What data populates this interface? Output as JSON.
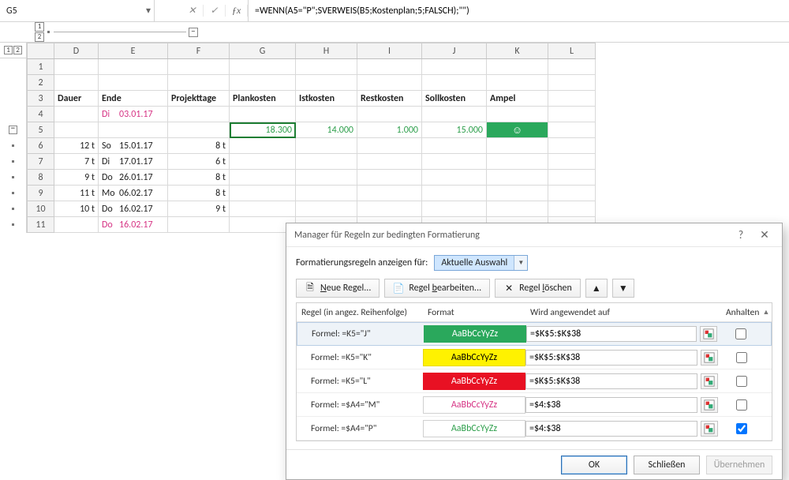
{
  "nameBox": "G5",
  "formula": "=WENN(A5=\"P\";SVERWEIS(B5;Kostenplan;5;FALSCH);\"\")",
  "outlineCols": {
    "one": "1",
    "two": "2"
  },
  "colHeads": [
    "D",
    "E",
    "F",
    "G",
    "H",
    "I",
    "J",
    "K",
    "L"
  ],
  "rowNums": [
    "1",
    "2",
    "3",
    "4",
    "5",
    "6",
    "7",
    "8",
    "9",
    "10",
    "11"
  ],
  "headers": {
    "D": "Dauer",
    "E": "Ende",
    "F": "Projekttage",
    "G": "Plankosten",
    "H": "Istkosten",
    "I": "Restkosten",
    "J": "Sollkosten",
    "K": "Ampel"
  },
  "row4": {
    "day": "Di",
    "date": "03.01.17"
  },
  "row5": {
    "G": "18.300",
    "H": "14.000",
    "I": "1.000",
    "J": "15.000",
    "K": "☺"
  },
  "rows": [
    {
      "n": "6",
      "D": "12 t",
      "day": "So",
      "date": "15.01.17",
      "F": "8 t"
    },
    {
      "n": "7",
      "D": "7 t",
      "day": "Di",
      "date": "17.01.17",
      "F": "6 t"
    },
    {
      "n": "8",
      "D": "9 t",
      "day": "Do",
      "date": "26.01.17",
      "F": "8 t"
    },
    {
      "n": "9",
      "D": "11 t",
      "day": "Mo",
      "date": "06.02.17",
      "F": "8 t"
    },
    {
      "n": "10",
      "D": "10 t",
      "day": "Do",
      "date": "16.02.17",
      "F": "9 t"
    },
    {
      "n": "11",
      "D": "",
      "day": "Do",
      "date": "16.02.17",
      "F": ""
    }
  ],
  "dialog": {
    "title": "Manager für Regeln zur bedingten Formatierung",
    "showForLabel": "Formatierungsregeln anzeigen für:",
    "showForValue": "Aktuelle Auswahl",
    "btnNew": "Neue Regel...",
    "btnEdit": "Regel bearbeiten...",
    "btnDelete": "Regel löschen",
    "hdrRule": "Regel (in angez. Reihenfolge)",
    "hdrFormat": "Format",
    "hdrApplies": "Wird angewendet auf",
    "hdrStop": "Anhalten",
    "sample": "AaBbCcYyZz",
    "rules": [
      {
        "formula": "Formel: =K5=\"J\"",
        "cls": "green",
        "range": "=$K$5:$K$38",
        "stop": false,
        "sel": true
      },
      {
        "formula": "Formel: =K5=\"K\"",
        "cls": "yellow",
        "range": "=$K$5:$K$38",
        "stop": false
      },
      {
        "formula": "Formel: =K5=\"L\"",
        "cls": "red",
        "range": "=$K$5:$K$38",
        "stop": false
      },
      {
        "formula": "Formel: =$A4=\"M\"",
        "cls": "mag",
        "range": "=$4:$38",
        "stop": false
      },
      {
        "formula": "Formel: =$A4=\"P\"",
        "cls": "grn",
        "range": "=$4:$38",
        "stop": true
      }
    ],
    "ok": "OK",
    "close": "Schließen",
    "apply": "Übernehmen"
  }
}
